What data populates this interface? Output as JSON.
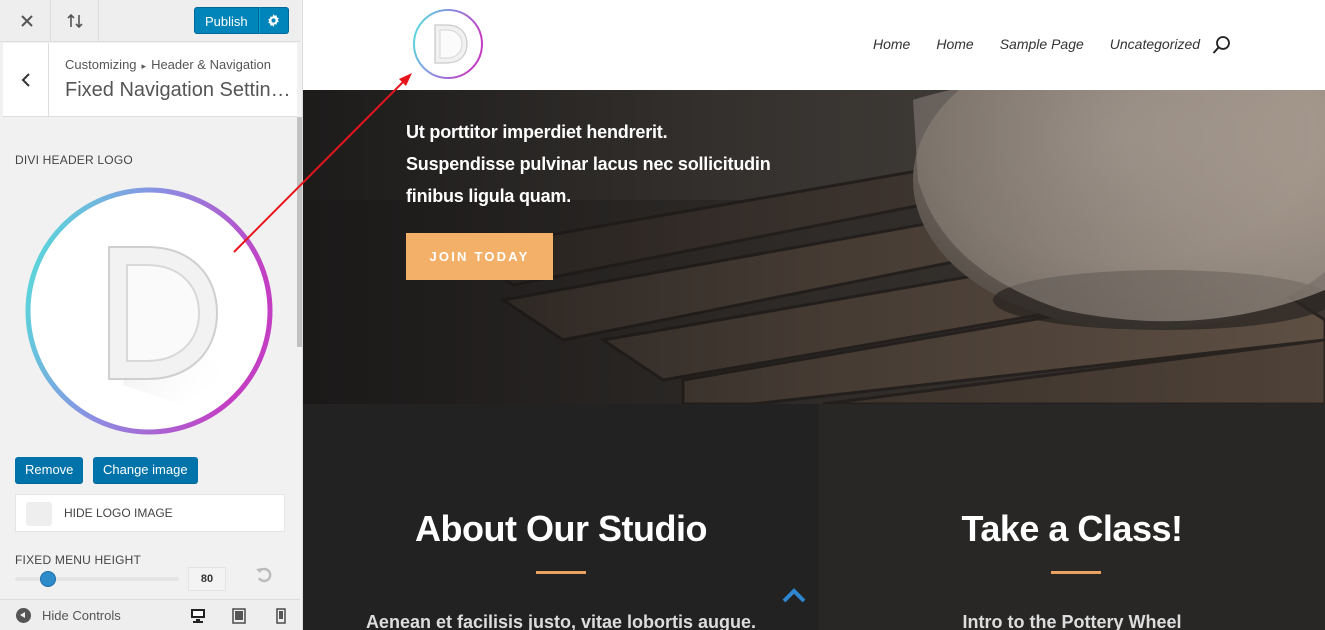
{
  "toolbar": {
    "close_icon": "close-icon",
    "reorder_icon": "sort-arrows-icon",
    "publish_label": "Publish",
    "settings_icon": "gear-icon",
    "accent_color": "#0085ba"
  },
  "section": {
    "breadcrumb_root": "Customizing",
    "breadcrumb_parent": "Header & Navigation",
    "title": "Fixed Navigation Settin…"
  },
  "controls": {
    "logo_label": "DIVI HEADER LOGO",
    "remove_label": "Remove",
    "change_label": "Change image",
    "hide_logo_label": "HIDE LOGO IMAGE",
    "hide_logo_checked": false,
    "menu_height_label": "FIXED MENU HEIGHT",
    "menu_height_value": "80",
    "menu_height_fraction": 0.2
  },
  "footer": {
    "hide_controls_label": "Hide Controls",
    "devices": [
      "desktop",
      "tablet",
      "mobile"
    ],
    "active_device": "desktop"
  },
  "site": {
    "nav": [
      "Home",
      "Home",
      "Sample Page",
      "Uncategorized"
    ],
    "search_icon": "search-icon",
    "hero_line1": "Ut porttitor imperdiet hendrerit.",
    "hero_line2": "Suspendisse pulvinar lacus nec sollicitudin",
    "hero_line3": "finibus ligula quam.",
    "join_label": "JOIN TODAY",
    "join_color": "#f3b069",
    "about_title": "About Our Studio",
    "about_text": "Aenean et facilisis justo, vitae lobortis augue.",
    "class_title": "Take a Class!",
    "class_text": "Intro to the Pottery Wheel",
    "accent_rule_color": "#e8a160"
  },
  "annotation_color": "#e8141c"
}
